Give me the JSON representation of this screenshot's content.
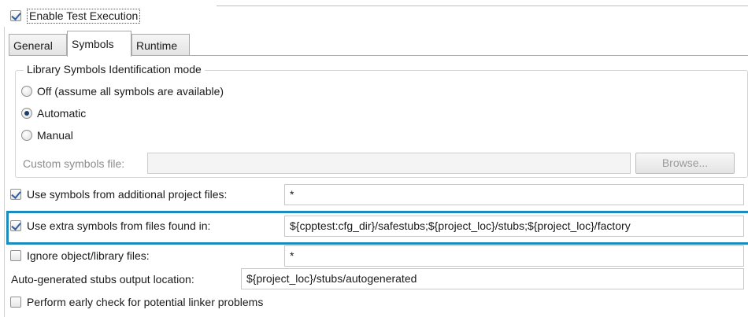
{
  "enable_test_execution": {
    "label": "Enable Test Execution",
    "checked": true
  },
  "tabs": [
    {
      "label": "General",
      "active": false
    },
    {
      "label": "Symbols",
      "active": true
    },
    {
      "label": "Runtime",
      "active": false
    }
  ],
  "library_mode": {
    "title": "Library Symbols Identification mode",
    "options": [
      {
        "label": "Off (assume all symbols are available)",
        "selected": false
      },
      {
        "label": "Automatic",
        "selected": true
      },
      {
        "label": "Manual",
        "selected": false
      }
    ],
    "custom_symbols_label": "Custom symbols file:",
    "custom_symbols_value": "",
    "browse_label": "Browse..."
  },
  "options": {
    "additional_project_files": {
      "label": "Use symbols from additional project files:",
      "checked": true,
      "value": "*"
    },
    "extra_symbols": {
      "label": "Use extra symbols from files found in:",
      "checked": true,
      "value": "${cpptest:cfg_dir}/safestubs;${project_loc}/stubs;${project_loc}/factory"
    },
    "ignore_object_files": {
      "label": "Ignore object/library files:",
      "checked": false,
      "value": "*"
    },
    "auto_stubs_location": {
      "label": "Auto-generated stubs output location:",
      "value": "${project_loc}/stubs/autogenerated"
    },
    "early_linker_check": {
      "label": "Perform early check for potential linker problems",
      "checked": false
    }
  },
  "colors": {
    "highlight": "#1c8cbf",
    "tab_border": "#a9a9a9"
  }
}
